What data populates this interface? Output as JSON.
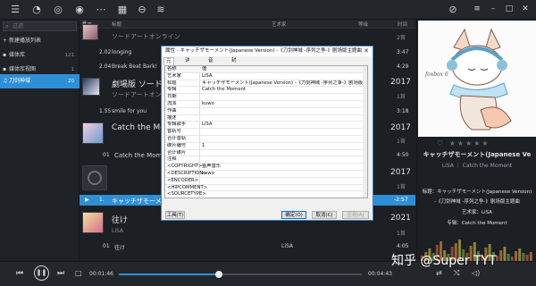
{
  "topbar": {
    "icons": [
      "list-icon",
      "user-icon",
      "disc-icon",
      "check-circle-icon",
      "more-icon",
      "grid-icon",
      "rss-icon"
    ],
    "right_icons": [
      "compass-icon",
      "menu-icon",
      "minimize-icon",
      "maximize-icon",
      "close-icon"
    ]
  },
  "sidebar": {
    "search_placeholder": "过滤",
    "items": [
      {
        "label": "新建播放列表",
        "count": ""
      },
      {
        "label": "媒体库",
        "count": "121"
      },
      {
        "label": "媒体库视图",
        "count": "1"
      },
      {
        "label": "刀剑神域",
        "count": "20"
      }
    ]
  },
  "list": {
    "headers": {
      "num": "#",
      "status": "状态",
      "title": "标题",
      "artist": "艺术家",
      "level": "等级",
      "time": "时间"
    },
    "rows": [
      {
        "kind": "title",
        "text": "ソードアートオンライン",
        "count": "2首"
      },
      {
        "kind": "track",
        "num": "2.02",
        "title": "longing",
        "time": "3:47"
      },
      {
        "kind": "track",
        "num": "2.04",
        "title": "Break Beat Bark!",
        "time": "4:29"
      },
      {
        "kind": "group",
        "title": "劇場版 ソードア",
        "year": "2017"
      },
      {
        "kind": "subtitle",
        "text": "ソードアートオン",
        "count": "1首"
      },
      {
        "kind": "track",
        "num": "1.55",
        "title": "smile for you",
        "time": "3:18"
      },
      {
        "kind": "group",
        "title": "Catch the Mome",
        "year": "2017"
      },
      {
        "kind": "subtitle",
        "text": "",
        "count": "1首"
      },
      {
        "kind": "track",
        "num": "01",
        "title": "Catch the Mom",
        "time": "4:50"
      },
      {
        "kind": "group",
        "title": "",
        "year": "2017"
      },
      {
        "kind": "subtitle",
        "text": "",
        "count": "1首"
      },
      {
        "kind": "selected",
        "num": "1.",
        "title": "キャッチザモーメ",
        "time": "-2:57"
      },
      {
        "kind": "group",
        "title": "往け",
        "year": "2021"
      },
      {
        "kind": "subtitle",
        "text": "LiSA",
        "count": "1首"
      },
      {
        "kind": "track",
        "num": "01",
        "title": "往け",
        "artist": "LiSA",
        "time": "4:05"
      }
    ]
  },
  "dialog": {
    "title": "属性 - キャッチザモーメント(Japanese Version) -《刀剑神域 -序列之争-》剧场版主题曲",
    "close": "✕",
    "tabs": [
      "元数据",
      "详细信息",
      "音轨增益",
      "封面"
    ],
    "columns": {
      "name": "名称",
      "value": "值"
    },
    "fields": [
      {
        "name": "艺术家",
        "value": "LiSA"
      },
      {
        "name": "标题",
        "value": "キャッチザモーメント(Japanese Version) -《刀剑神域 -序列之争-》剧场版主题曲"
      },
      {
        "name": "专辑",
        "value": "Catch the Moment"
      },
      {
        "name": "日期",
        "value": ""
      },
      {
        "name": "流派",
        "value": "kuwo"
      },
      {
        "name": "作曲",
        "value": ""
      },
      {
        "name": "描述",
        "value": ""
      },
      {
        "name": "专辑歌手",
        "value": "LiSA"
      },
      {
        "name": "音轨号",
        "value": ""
      },
      {
        "name": "合计音轨",
        "value": ""
      },
      {
        "name": "碟片编号",
        "value": "1"
      },
      {
        "name": "合计碟片",
        "value": ""
      },
      {
        "name": "注释",
        "value": ""
      },
      {
        "name": "<COPYRIGHT>",
        "value": "鱼声音乐"
      },
      {
        "name": "<DESCRIPTION>",
        "value": "kuwo"
      },
      {
        "name": "<ENCODER>",
        "value": ""
      },
      {
        "name": "<HIPCOMMENT>",
        "value": ""
      },
      {
        "name": "<SOURCETYPE>",
        "value": ""
      },
      {
        "name": "<UNSYNCEDLYRICS>",
        "value": ""
      }
    ],
    "buttons": {
      "tools": "工具(T)",
      "ok": "确定(O)",
      "cancel": "取消(C)",
      "apply": "应用(A)"
    }
  },
  "right_panel": {
    "cover_text": "foxbox 6",
    "title": "キャッチザモーメント(Japanese Ve",
    "subtitle": "LiSA ｜ Catch the Moment",
    "info_title": "标题：キャッチザモーメント(Japanese Version)",
    "info_title2": "-《刀剑神域 -序列之争-》剧场版主题曲",
    "info_artist": "艺术家：LiSA",
    "info_album": "专辑：Catch the Moment",
    "rating_stars": 0
  },
  "player": {
    "elapsed": "00:01:46",
    "remaining": "00:04:43",
    "progress_fraction": 0.41,
    "watermark": "知乎 @Super TYT"
  }
}
